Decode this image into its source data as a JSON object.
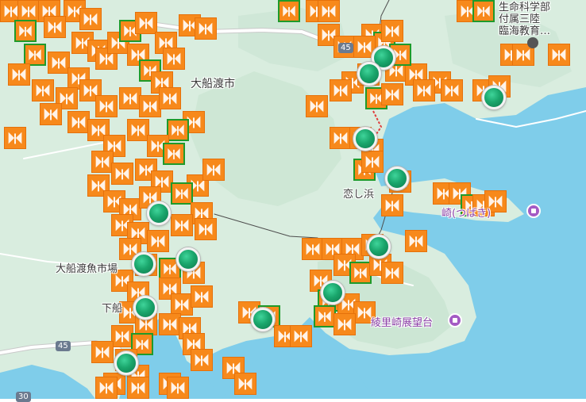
{
  "colors": {
    "land": "#d9eddf",
    "land_dark": "#c6e2cf",
    "water": "#7fcdea",
    "road": "#ffffff",
    "road_edge": "#c9c9c9",
    "marker_orange": "#f7891b",
    "marker_green_edge": "#1f9a2a",
    "station_green": "#1aa66c",
    "poi_purple": "#a45bc4"
  },
  "labels": {
    "ofunato_city": "大船渡市",
    "koishihama": "恋し浜",
    "ofunato_fish_market": "大船渡魚市場",
    "shimo": "下船",
    "ryori_observatory": "綾里崎展望台",
    "cape": "崎(つばき)",
    "education": "生命科学部付属三陸臨海教育…",
    "edu_line1": "生命科学部",
    "edu_line2": "付属三陸",
    "edu_line3": "臨海教育…",
    "route_45_top": "45",
    "route_45_bottom": "45",
    "route_30": "30"
  },
  "icons": {
    "marker": "tsunami-sign-icon",
    "station": "green-station-icon",
    "poi": "landmark-icon"
  }
}
